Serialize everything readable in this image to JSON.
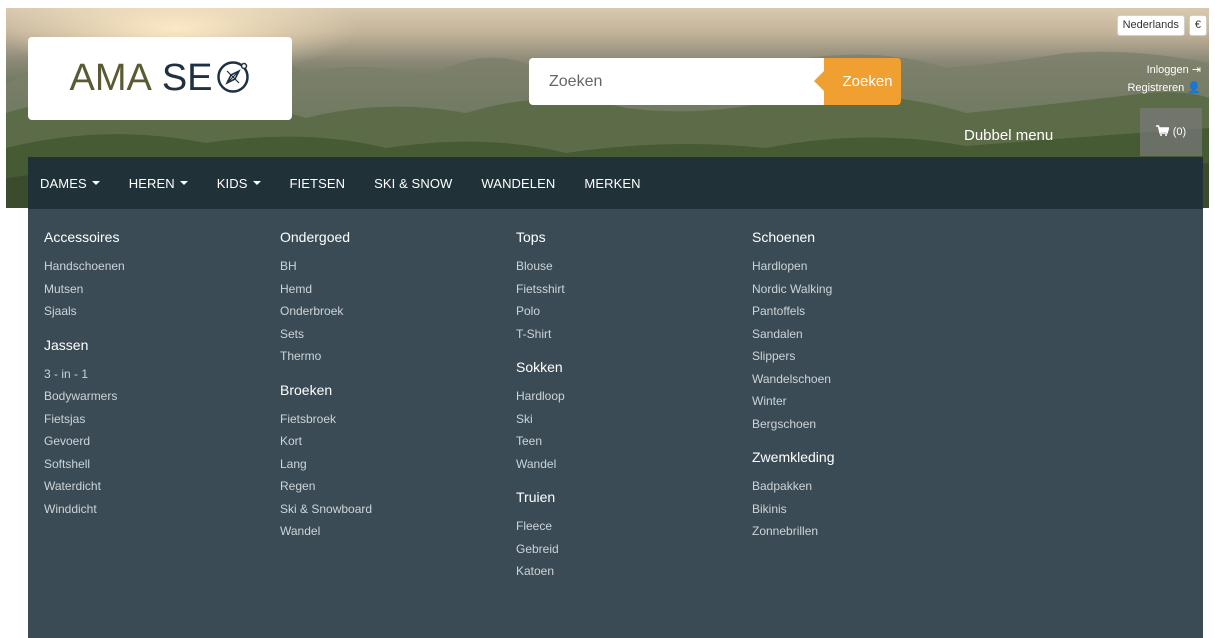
{
  "header": {
    "logo": {
      "word1": "AMA",
      "word2": "SE",
      "compass_icon": "compass-icon"
    },
    "search": {
      "placeholder": "Zoeken",
      "button_label": "Zoeken"
    },
    "language": "Nederlands",
    "currency": "€",
    "login_label": "Inloggen",
    "register_label": "Registreren",
    "dubbel_menu": "Dubbel menu",
    "cart_label": "(0)",
    "colors": {
      "accent": "#f0a030",
      "navbar": "#203238",
      "menu_bg": "#3b4b55"
    }
  },
  "nav": {
    "items": [
      {
        "label": "DAMES",
        "dropdown": true
      },
      {
        "label": "HEREN",
        "dropdown": true
      },
      {
        "label": "KIDS",
        "dropdown": true
      },
      {
        "label": "FIETSEN",
        "dropdown": false
      },
      {
        "label": "SKI & SNOW",
        "dropdown": false
      },
      {
        "label": "WANDELEN",
        "dropdown": false
      },
      {
        "label": "MERKEN",
        "dropdown": false
      }
    ]
  },
  "mega_menu": {
    "columns": [
      {
        "groups": [
          {
            "title": "Accessoires",
            "items": [
              "Handschoenen",
              "Mutsen",
              "Sjaals"
            ]
          },
          {
            "title": "Jassen",
            "items": [
              "3 - in - 1",
              "Bodywarmers",
              "Fietsjas",
              "Gevoerd",
              "Softshell",
              "Waterdicht",
              "Winddicht"
            ]
          }
        ]
      },
      {
        "groups": [
          {
            "title": "Ondergoed",
            "items": [
              "BH",
              "Hemd",
              "Onderbroek",
              "Sets",
              "Thermo"
            ]
          },
          {
            "title": "Broeken",
            "items": [
              "Fietsbroek",
              "Kort",
              "Lang",
              "Regen",
              "Ski & Snowboard",
              "Wandel"
            ]
          }
        ]
      },
      {
        "groups": [
          {
            "title": "Tops",
            "items": [
              "Blouse",
              "Fietsshirt",
              "Polo",
              "T-Shirt"
            ]
          },
          {
            "title": "Sokken",
            "items": [
              "Hardloop",
              "Ski",
              "Teen",
              "Wandel"
            ]
          },
          {
            "title": "Truien",
            "items": [
              "Fleece",
              "Gebreid",
              "Katoen"
            ]
          }
        ]
      },
      {
        "groups": [
          {
            "title": "Schoenen",
            "items": [
              "Hardlopen",
              "Nordic Walking",
              "Pantoffels",
              "Sandalen",
              "Slippers",
              "Wandelschoen",
              "Winter",
              "Bergschoen"
            ]
          },
          {
            "title": "Zwemkleding",
            "items": [
              "Badpakken",
              "Bikinis",
              "Zonnebrillen"
            ]
          }
        ]
      }
    ]
  }
}
